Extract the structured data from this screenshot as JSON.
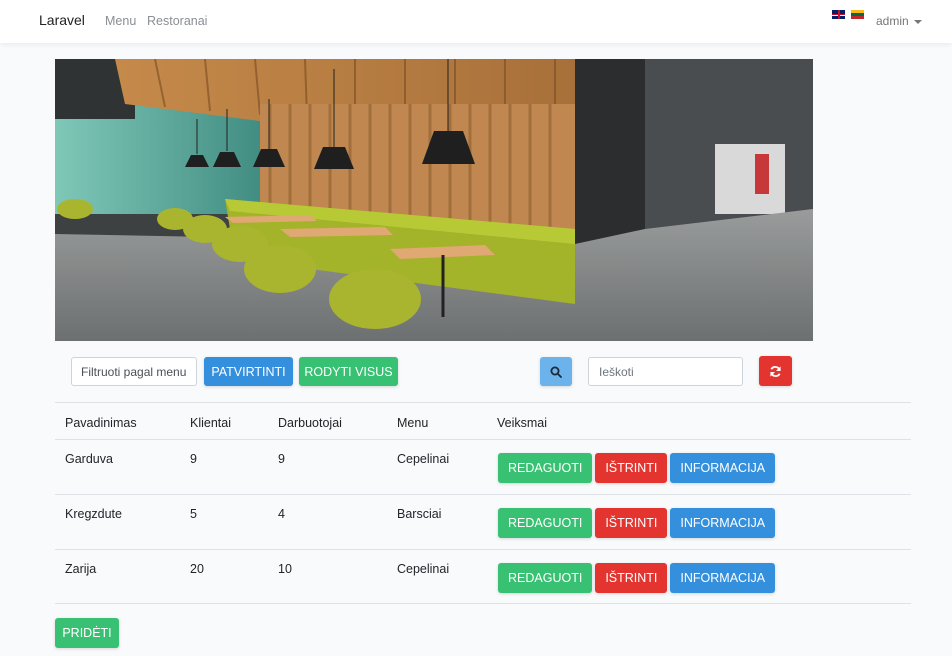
{
  "navbar": {
    "brand": "Laravel",
    "links": [
      "Menu",
      "Restoranai"
    ],
    "user": "admin",
    "flags": [
      "flag-en-icon",
      "flag-lt-icon"
    ]
  },
  "filter": {
    "placeholder": "Filtruoti pagal menu",
    "confirm_label": "PATVIRTINTI",
    "show_all_label": "RODYTI VISUS"
  },
  "search": {
    "placeholder": "Ieškoti",
    "button_icon": "search-icon",
    "reset_icon": "refresh-icon"
  },
  "table": {
    "headers": [
      "Pavadinimas",
      "Klientai",
      "Darbuotojai",
      "Menu",
      "Veiksmai"
    ],
    "rows": [
      {
        "name": "Garduva",
        "clients": "9",
        "workers": "9",
        "menu": "Cepelinai"
      },
      {
        "name": "Kregzdute",
        "clients": "5",
        "workers": "4",
        "menu": "Barsciai"
      },
      {
        "name": "Zarija",
        "clients": "20",
        "workers": "10",
        "menu": "Cepelinai"
      }
    ],
    "actions": {
      "edit": "REDAGUOTI",
      "delete": "IŠTRINTI",
      "info": "INFORMACIJA"
    }
  },
  "add_label": "PRIDĖTI",
  "colors": {
    "primary": "#3490dc",
    "success": "#38c172",
    "danger": "#e3342f",
    "info": "#6cb2eb"
  }
}
